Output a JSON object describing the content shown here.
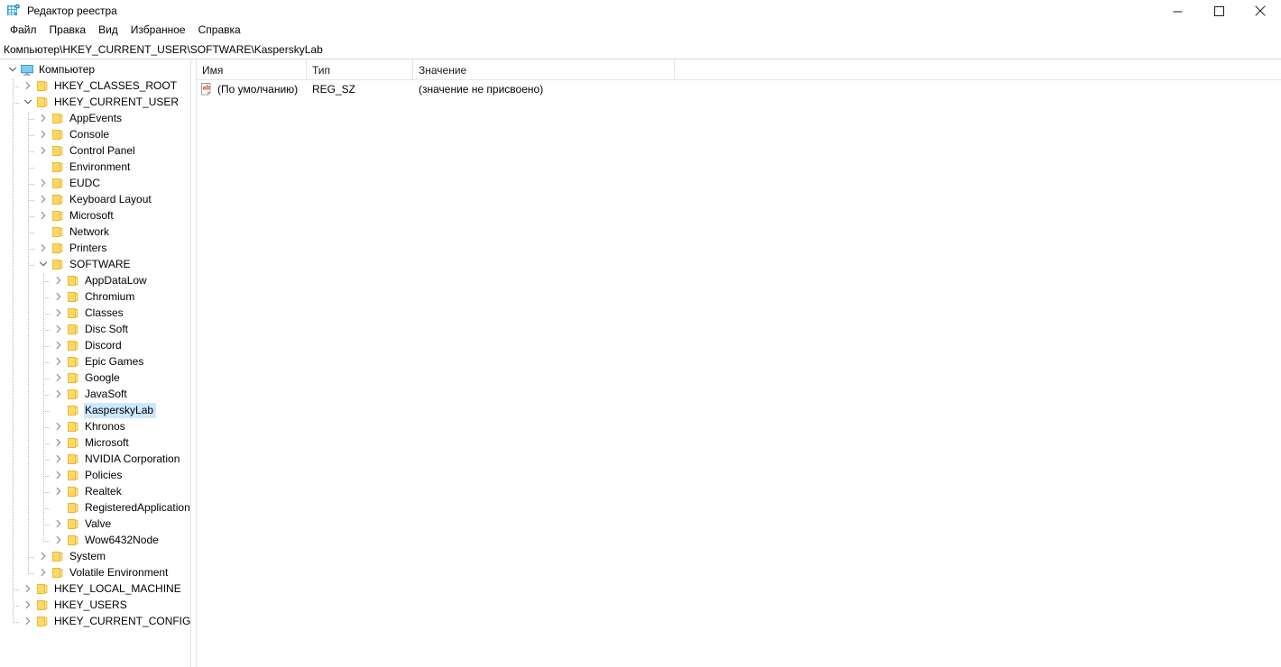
{
  "window": {
    "title": "Редактор реестра",
    "icon": "registry-editor-icon",
    "controls": {
      "minimize": "minimize-icon",
      "maximize": "maximize-icon",
      "close": "close-icon"
    }
  },
  "menubar": {
    "items": [
      {
        "label": "Файл"
      },
      {
        "label": "Правка"
      },
      {
        "label": "Вид"
      },
      {
        "label": "Избранное"
      },
      {
        "label": "Справка"
      }
    ]
  },
  "addressbar": {
    "path": "Компьютер\\HKEY_CURRENT_USER\\SOFTWARE\\KasperskyLab"
  },
  "tree": {
    "nodes": [
      {
        "label": "Компьютер",
        "depth": 0,
        "state": "expanded",
        "icon": "computer-icon"
      },
      {
        "label": "HKEY_CLASSES_ROOT",
        "depth": 1,
        "state": "collapsed",
        "icon": "folder-icon"
      },
      {
        "label": "HKEY_CURRENT_USER",
        "depth": 1,
        "state": "expanded",
        "icon": "folder-icon"
      },
      {
        "label": "AppEvents",
        "depth": 2,
        "state": "collapsed",
        "icon": "folder-icon"
      },
      {
        "label": "Console",
        "depth": 2,
        "state": "collapsed",
        "icon": "folder-icon"
      },
      {
        "label": "Control Panel",
        "depth": 2,
        "state": "collapsed",
        "icon": "folder-icon"
      },
      {
        "label": "Environment",
        "depth": 2,
        "state": "leaf",
        "icon": "folder-icon"
      },
      {
        "label": "EUDC",
        "depth": 2,
        "state": "collapsed",
        "icon": "folder-icon"
      },
      {
        "label": "Keyboard Layout",
        "depth": 2,
        "state": "collapsed",
        "icon": "folder-icon"
      },
      {
        "label": "Microsoft",
        "depth": 2,
        "state": "collapsed",
        "icon": "folder-icon"
      },
      {
        "label": "Network",
        "depth": 2,
        "state": "leaf",
        "icon": "folder-icon"
      },
      {
        "label": "Printers",
        "depth": 2,
        "state": "collapsed",
        "icon": "folder-icon"
      },
      {
        "label": "SOFTWARE",
        "depth": 2,
        "state": "expanded",
        "icon": "folder-icon"
      },
      {
        "label": "AppDataLow",
        "depth": 3,
        "state": "collapsed",
        "icon": "folder-icon"
      },
      {
        "label": "Chromium",
        "depth": 3,
        "state": "collapsed",
        "icon": "folder-icon"
      },
      {
        "label": "Classes",
        "depth": 3,
        "state": "collapsed",
        "icon": "folder-icon"
      },
      {
        "label": "Disc Soft",
        "depth": 3,
        "state": "collapsed",
        "icon": "folder-icon"
      },
      {
        "label": "Discord",
        "depth": 3,
        "state": "collapsed",
        "icon": "folder-icon"
      },
      {
        "label": "Epic Games",
        "depth": 3,
        "state": "collapsed",
        "icon": "folder-icon"
      },
      {
        "label": "Google",
        "depth": 3,
        "state": "collapsed",
        "icon": "folder-icon"
      },
      {
        "label": "JavaSoft",
        "depth": 3,
        "state": "collapsed",
        "icon": "folder-icon"
      },
      {
        "label": "KasperskyLab",
        "depth": 3,
        "state": "leaf",
        "icon": "folder-icon",
        "selected": true
      },
      {
        "label": "Khronos",
        "depth": 3,
        "state": "collapsed",
        "icon": "folder-icon"
      },
      {
        "label": "Microsoft",
        "depth": 3,
        "state": "collapsed",
        "icon": "folder-icon"
      },
      {
        "label": "NVIDIA Corporation",
        "depth": 3,
        "state": "collapsed",
        "icon": "folder-icon"
      },
      {
        "label": "Policies",
        "depth": 3,
        "state": "collapsed",
        "icon": "folder-icon"
      },
      {
        "label": "Realtek",
        "depth": 3,
        "state": "collapsed",
        "icon": "folder-icon"
      },
      {
        "label": "RegisteredApplications",
        "depth": 3,
        "state": "leaf",
        "icon": "folder-icon"
      },
      {
        "label": "Valve",
        "depth": 3,
        "state": "collapsed",
        "icon": "folder-icon"
      },
      {
        "label": "Wow6432Node",
        "depth": 3,
        "state": "collapsed",
        "icon": "folder-icon"
      },
      {
        "label": "System",
        "depth": 2,
        "state": "collapsed",
        "icon": "folder-icon"
      },
      {
        "label": "Volatile Environment",
        "depth": 2,
        "state": "collapsed",
        "icon": "folder-icon"
      },
      {
        "label": "HKEY_LOCAL_MACHINE",
        "depth": 1,
        "state": "collapsed",
        "icon": "folder-icon"
      },
      {
        "label": "HKEY_USERS",
        "depth": 1,
        "state": "collapsed",
        "icon": "folder-icon"
      },
      {
        "label": "HKEY_CURRENT_CONFIG",
        "depth": 1,
        "state": "collapsed",
        "icon": "folder-icon"
      }
    ]
  },
  "list": {
    "columns": [
      {
        "label": "Имя",
        "key": "name"
      },
      {
        "label": "Тип",
        "key": "type"
      },
      {
        "label": "Значение",
        "key": "value"
      }
    ],
    "rows": [
      {
        "icon": "string-value-icon",
        "name": "(По умолчанию)",
        "type": "REG_SZ",
        "value": "(значение не присвоено)"
      }
    ]
  },
  "colors": {
    "selection": "#cce8ff",
    "folder": "#ffd966",
    "folder_edge": "#e8b800",
    "accent": "#0078d7",
    "border": "#e2e2e2"
  }
}
